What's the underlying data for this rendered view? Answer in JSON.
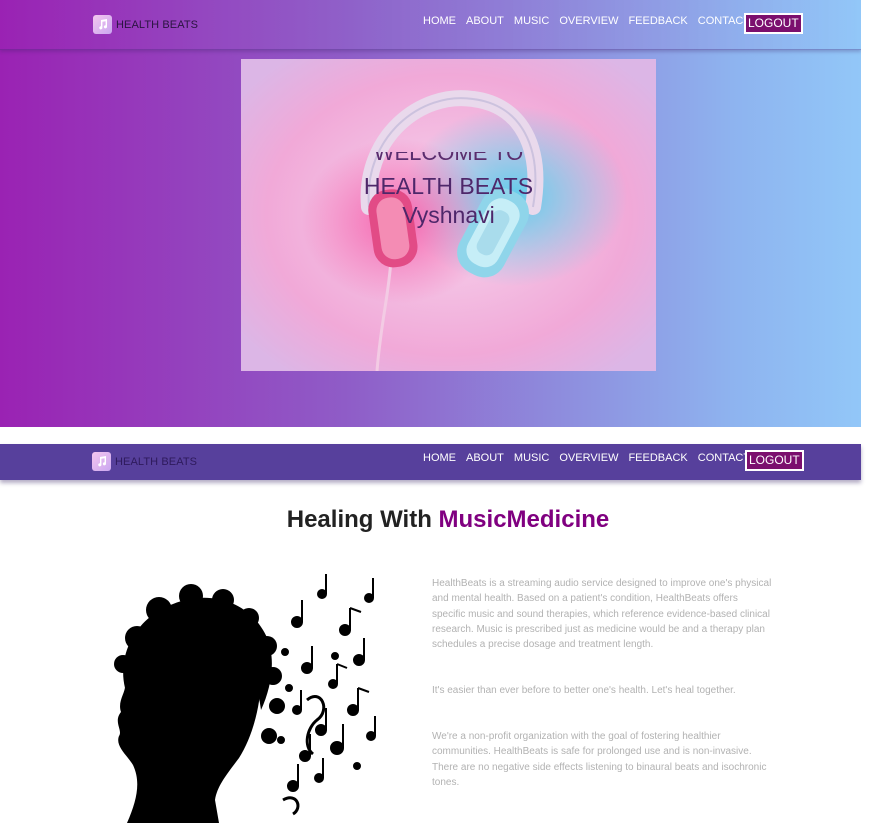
{
  "brand": {
    "name": "HEALTH BEATS",
    "logo_icon": "music-note-icon"
  },
  "nav": {
    "items": [
      "HOME",
      "ABOUT",
      "MUSIC",
      "OVERVIEW",
      "FEEDBACK",
      "CONTACT US"
    ],
    "logout_label": "LOGOUT"
  },
  "hero": {
    "welcome": "WELCOME TO",
    "title": "HEALTH BEATS",
    "user": "Vyshnavi",
    "image": "headphones-photo"
  },
  "about": {
    "title_prefix": "Healing With ",
    "title_accent": "MusicMedicine",
    "image": "music-head-silhouette",
    "paragraphs": [
      "HealthBeats is a streaming audio service designed to improve one's physical and mental health. Based on a patient's condition, HealthBeats offers specific music and sound therapies, which reference evidence-based clinical research. Music is prescribed just as medicine would be and a therapy plan schedules a precise dosage and treatment length.",
      "It's easier than ever before to better one's health. Let's heal together.",
      "We're a non-profit organization with the goal of fostering healthier communities. HealthBeats is safe for prolonged use and is non-invasive. There are no negative side effects listening to binaural beats and isochronic tones."
    ]
  },
  "colors": {
    "accent": "#800080",
    "nav_dark": "#57409c",
    "gradient_start": "#9a22b3",
    "gradient_end": "#92c7f8"
  }
}
